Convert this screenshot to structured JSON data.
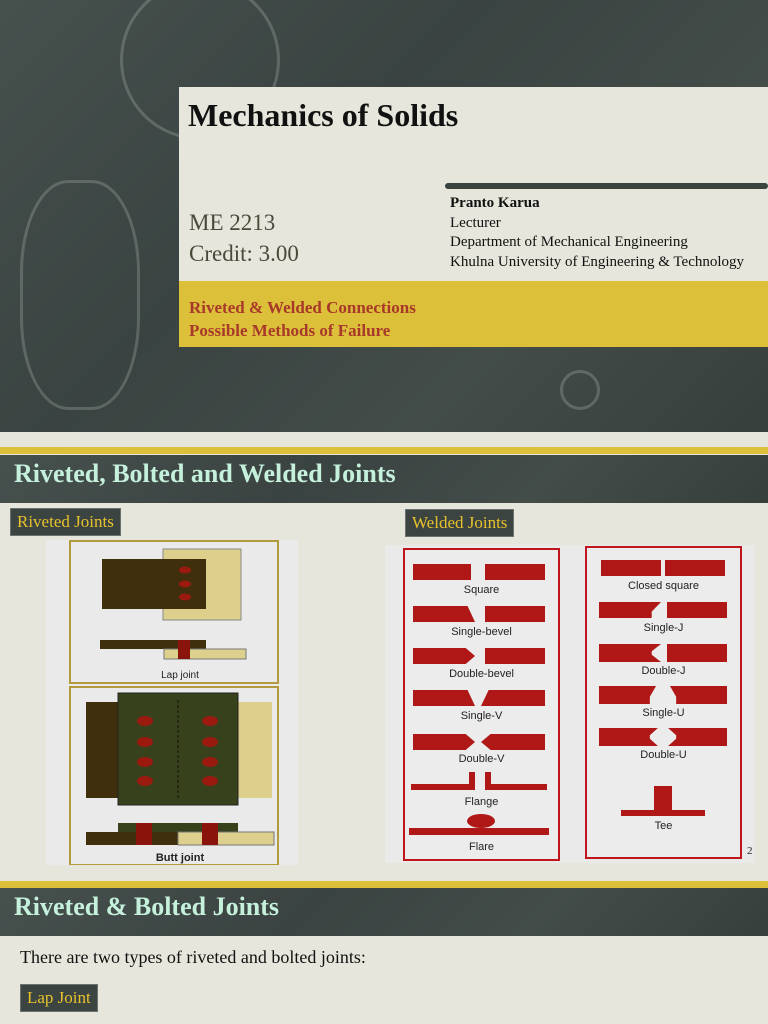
{
  "slide1": {
    "title": "Mechanics of Solids",
    "course_code": "ME 2213",
    "credit": "Credit: 3.00",
    "author": {
      "name": "Pranto Karua",
      "role": "Lecturer",
      "department": "Department of Mechanical Engineering",
      "university": "Khulna University of Engineering & Technology"
    },
    "topics": [
      "Riveted & Welded Connections",
      "Possible Methods of Failure"
    ]
  },
  "slide2": {
    "heading": "Riveted, Bolted and Welded Joints",
    "riveted_label": "Riveted Joints",
    "welded_label": "Welded Joints",
    "lap_caption": "Lap joint",
    "butt_caption": "Butt joint",
    "welds_left": [
      "Square",
      "Single-bevel",
      "Double-bevel",
      "Single-V",
      "Double-V",
      "Flange",
      "Flare"
    ],
    "welds_right": [
      "Closed square",
      "Single-J",
      "Double-J",
      "Single-U",
      "Double-U",
      "Tee"
    ],
    "page_number": "2"
  },
  "slide3": {
    "heading": "Riveted & Bolted Joints",
    "intro": "There are two types of riveted and bolted joints:",
    "lap_label": "Lap Joint"
  },
  "colors": {
    "accent_yellow": "#dcc03a",
    "chalkboard": "#3b4441",
    "weld_red": "#b01818"
  }
}
